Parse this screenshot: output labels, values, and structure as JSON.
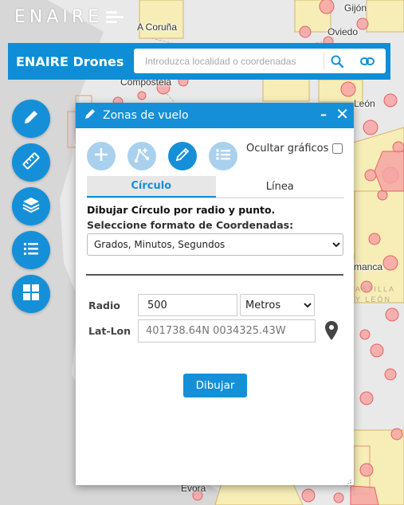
{
  "logo": {
    "text": "ENAIRE"
  },
  "header": {
    "title": "ENAIRE Drones",
    "search_placeholder": "Introduzca localidad o coordenadas",
    "search_value": ""
  },
  "map": {
    "cities": [
      "Gijón",
      "A Coruña",
      "Oviedo",
      "Compostela",
      "León",
      "manca",
      "Évora"
    ],
    "regions": [
      "ASTILLA",
      "Y LEÓN"
    ]
  },
  "left_toolbar": {
    "buttons": [
      "pencil-icon",
      "ruler-icon",
      "layers-icon",
      "list-icon",
      "grid-icon"
    ]
  },
  "dialog": {
    "title": "Zonas de vuelo",
    "minimize": "–",
    "close": "✕",
    "hide_graphics_label": "Ocultar gráficos",
    "hide_graphics_checked": false,
    "tabs": {
      "circle": "Círculo",
      "line": "Línea"
    },
    "description": "Dibujar Círculo por radio y punto.",
    "coord_format_label": "Seleccione formato de Coordenadas:",
    "coord_format_value": "Grados, Minutos, Segundos",
    "radius_label": "Radio",
    "radius_value": "500",
    "unit_value": "Metros",
    "latlon_label": "Lat-Lon",
    "latlon_placeholder": "401738.64N 0034325.43W",
    "draw_button": "Dibujar"
  },
  "colors": {
    "accent": "#1590d8",
    "header_bg": "#0e8ed6",
    "zone_red": "#f28b8b",
    "zone_yellow": "#f4ecb0"
  }
}
